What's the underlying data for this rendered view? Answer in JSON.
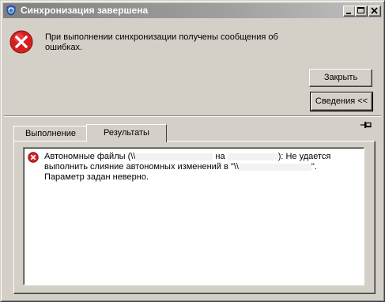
{
  "window": {
    "title": "Синхронизация завершена"
  },
  "message": {
    "text": "При выполнении синхронизации получены сообщения об ошибках."
  },
  "buttons": {
    "close_label": "Закрыть",
    "details_label": "Сведения <<"
  },
  "tabs": [
    {
      "label": "Выполнение",
      "active": false
    },
    {
      "label": "Результаты",
      "active": true
    }
  ],
  "results": {
    "items": [
      {
        "icon": "error-icon",
        "part1": "Автономные файлы (\\\\",
        "part2": "на",
        "part3": "): Не удается выполнить слияние автономных изменений в \"\\\\",
        "part4": "\".",
        "part5": "Параметр задан неверно."
      }
    ]
  },
  "colors": {
    "error_red": "#d42020",
    "titlebar_inactive": "#808080"
  }
}
